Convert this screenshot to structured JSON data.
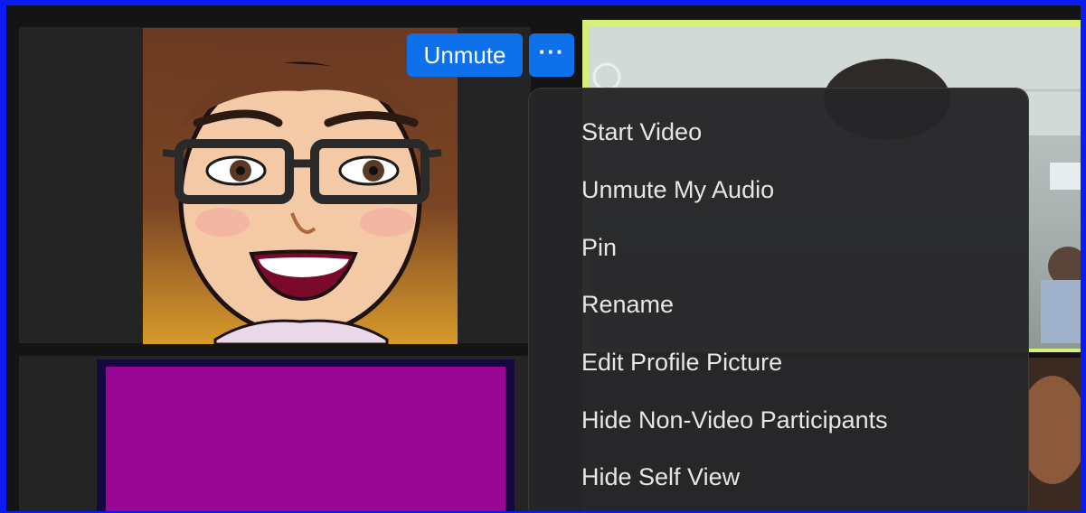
{
  "self_tile": {
    "unmute_label": "Unmute",
    "more_label": "···",
    "more_icon": "ellipsis-icon"
  },
  "context_menu": {
    "items": [
      {
        "label": "Start Video"
      },
      {
        "label": "Unmute My Audio"
      },
      {
        "label": "Pin"
      },
      {
        "label": "Rename"
      },
      {
        "label": "Edit Profile Picture"
      },
      {
        "label": "Hide Non-Video Participants"
      },
      {
        "label": "Hide Self View"
      }
    ]
  },
  "colors": {
    "accent": "#0e71eb",
    "frame_border": "#0b1af0",
    "active_speaker_border": "#d8f07a",
    "menu_bg": "#262628"
  }
}
